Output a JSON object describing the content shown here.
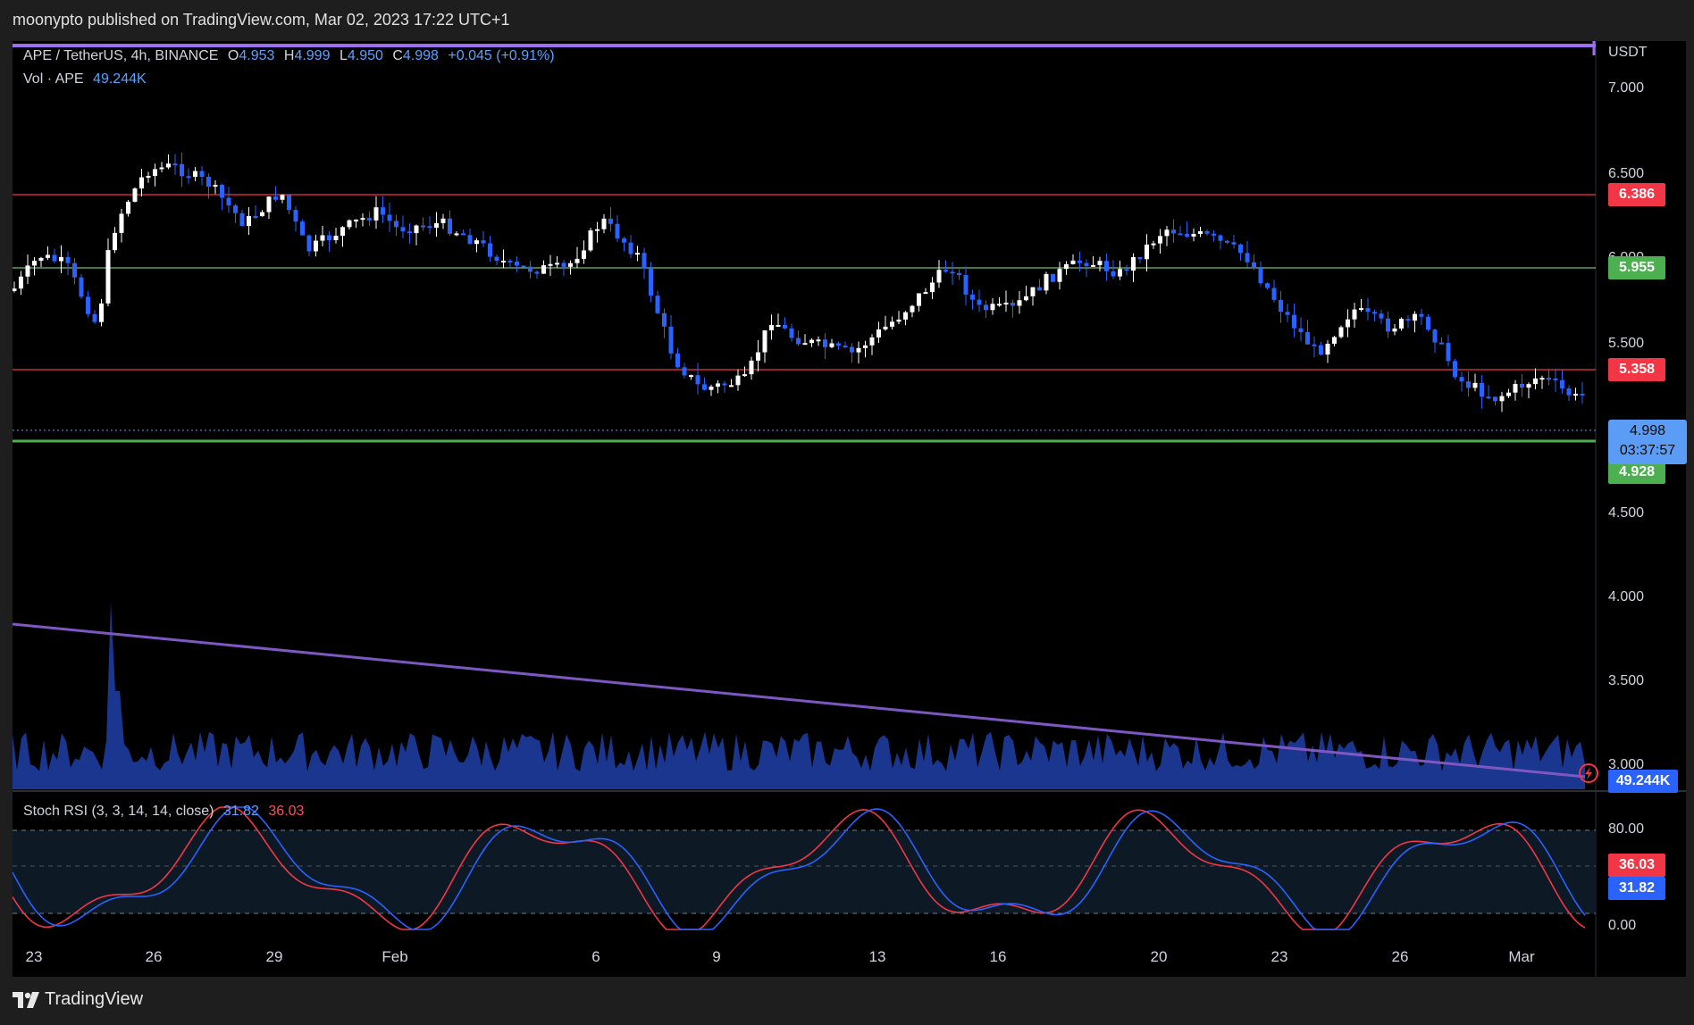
{
  "header": {
    "published": "moonypto published on TradingView.com, Mar 02, 2023 17:22 UTC+1"
  },
  "legend": {
    "symbol": "APE / TetherUS, 4h, BINANCE",
    "o_label": "O",
    "o": "4.953",
    "h_label": "H",
    "h": "4.999",
    "l_label": "L",
    "l": "4.950",
    "c_label": "C",
    "c": "4.998",
    "change": "+0.045 (+0.91%)",
    "vol_label": "Vol · APE",
    "vol": "49.244K"
  },
  "price_axis": {
    "currency": "USDT",
    "ticks": [
      "7.000",
      "6.500",
      "6.000",
      "5.500",
      "4.500",
      "4.000",
      "3.500",
      "3.000"
    ],
    "levels": [
      {
        "value": "6.386",
        "color": "#f23645"
      },
      {
        "value": "5.955",
        "color": "#4caf50"
      },
      {
        "value": "5.358",
        "color": "#f23645"
      },
      {
        "value": "4.928",
        "color": "#4caf50"
      }
    ],
    "last_price": "4.998",
    "countdown": "03:37:57",
    "volume_badge": "49.244K"
  },
  "stoch": {
    "label": "Stoch RSI (3, 3, 14, 14, close)",
    "k": "31.82",
    "d": "36.03",
    "ticks": [
      "80.00",
      "0.00"
    ]
  },
  "time_axis": [
    "23",
    "26",
    "29",
    "Feb",
    "6",
    "9",
    "13",
    "16",
    "20",
    "23",
    "26",
    "Mar"
  ],
  "footer": {
    "brand": "TradingView"
  },
  "colors": {
    "up": "#ffffff",
    "down": "#2962ff",
    "trend": "#7e57c2",
    "k_line": "#2962ff",
    "d_line": "#f23645"
  }
}
